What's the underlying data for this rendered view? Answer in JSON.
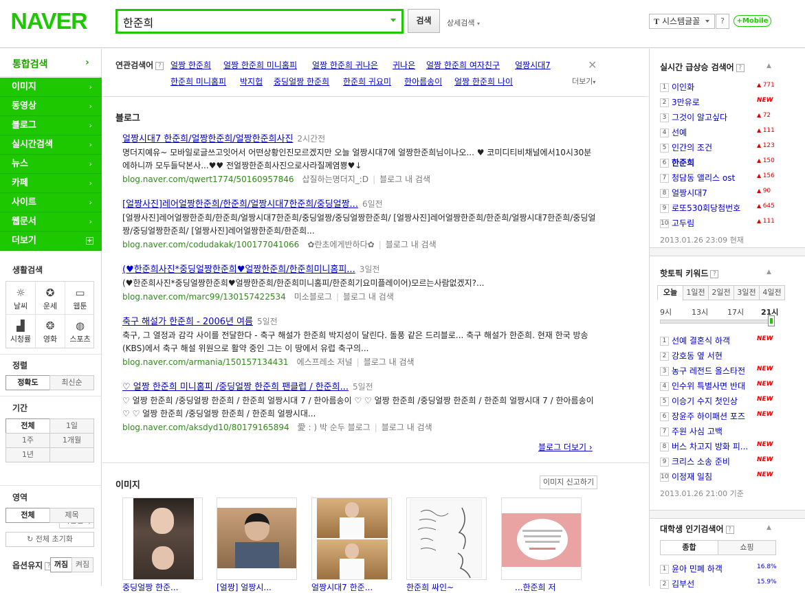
{
  "header": {
    "logo": "NAVER",
    "search_value": "한준희",
    "search_button": "검색",
    "advanced": "상세검색",
    "font_select": "시스템글꼴",
    "help": "?",
    "mobile": "+Mobile"
  },
  "leftnav": {
    "top": "통합검색",
    "items": [
      {
        "label": "이미지"
      },
      {
        "label": "동영상"
      },
      {
        "label": "블로그"
      },
      {
        "label": "실시간검색"
      },
      {
        "label": "뉴스"
      },
      {
        "label": "카페"
      },
      {
        "label": "사이트"
      },
      {
        "label": "웹문서"
      },
      {
        "label": "더보기"
      }
    ],
    "life_title": "생활검색",
    "life": [
      {
        "label": "날씨",
        "icon": "sun-icon"
      },
      {
        "label": "운세",
        "icon": "star-icon"
      },
      {
        "label": "웹툰",
        "icon": "speech-icon"
      },
      {
        "label": "시청률",
        "icon": "bar-chart-icon"
      },
      {
        "label": "영화",
        "icon": "film-reel-icon"
      },
      {
        "label": "스포츠",
        "icon": "ball-icon"
      }
    ],
    "sort_title": "정렬",
    "sort": [
      "정확도",
      "최신순"
    ],
    "period_title": "기간",
    "period": [
      "전체",
      "1일",
      "1주",
      "1개월",
      "1년",
      ""
    ],
    "direct_input": "직접입력",
    "area_title": "영역",
    "area": [
      "전체",
      "제목"
    ],
    "reset": "전체 초기화",
    "option_title": "옵션유지",
    "option": [
      "꺼짐",
      "켜짐"
    ]
  },
  "related": {
    "title": "연관검색어",
    "row1": [
      "얼짱 한준희",
      "얼짱 한준희 미니홈피",
      "얼짱 한준희 귀나은",
      "귀나은",
      "얼짱 한준희 여자친구",
      "얼짱시대7"
    ],
    "row2": [
      "한준희 미니홈피",
      "박지헙",
      "중딩얼짱 한준희",
      "한준희 귀요미",
      "한아름송이",
      "얼짱 한준희 나이"
    ],
    "more": "더보기"
  },
  "blog": {
    "title": "블로그",
    "results": [
      {
        "title": "얼짱시대7 한준희/얼짱한준희/얼짱한준희사진",
        "time": "2시간전",
        "desc": "명더지예유~ 모바일로글쓰고잇어서 어떤상황인진모르겠지만 오늘 얼짱시대7에 얼짱한준희님이나오... ♥ 코미디티비채널에서10시30분에하니까 모두들닥본사...♥♥ 전얼짱한준희사진으로사라질께염뿅♥↓",
        "url": "blog.naver.com/qwert1774/50160957846",
        "meta": "삽질하는명더지_:D",
        "inblog": "블로그 내 검색"
      },
      {
        "title": "[얼짱사진]레어얼짱한준희/한준희/얼짱시대7한준희/중딩얼짱...",
        "time": "6일전",
        "desc": "[얼짱사진]레어얼짱한준희/한준희/얼짱시대7한준희/중딩얼짱/중딩얼짱한준희/ [얼짱사진]레어얼짱한준희/한준희/얼짱시대7한준희/중딩얼짱/중딩얼짱한준희/ [얼짱사진]레어얼짱한준희/한준희...",
        "url": "blog.naver.com/codudakak/100177041066",
        "meta": "✿란초에게반하다✿",
        "inblog": "블로그 내 검색"
      },
      {
        "title": "(♥한준희사진*중딩얼짱한준희♥얼짱한준희/한준희미니홈피...",
        "time": "3일전",
        "desc": "(♥한준희사진*중딩얼짱한준희♥얼짱한준희/한준희미니홈피/한준희기요미플레이어)모르는사람없겠지?...",
        "url": "blog.naver.com/marc99/130157422534",
        "meta": "미소블로그",
        "inblog": "블로그 내 검색"
      },
      {
        "title": "축구 해설가 한준희 - 2006년 여름",
        "time": "5일전",
        "desc": "축구, 그 열정과 감각 사이를 전달한다 - 축구 해설가 한준희 박지성이 달린다. 돌풍 같은 드리블로... 축구 해설가 한준희. 현재 한국 방송(KBS)에서 축구 해설 위원으로 활약 중인 그는 이 땅에서 유럽 축구의...",
        "url": "blog.naver.com/armania/150157134431",
        "meta": "에스프레소 저널",
        "inblog": "블로그 내 검색"
      },
      {
        "title": "♡ 얼짱 한준희 미니홈피 /중딩얼짱 한준희 팬클럽 / 한준희...",
        "time": "5일전",
        "desc": "♡ 얼짱 한준희 /중딩얼짱 한준희 / 한준희 얼짱시대 7 / 한아름송이 ♡ ♡ 얼짱 한준희 /중딩얼짱 한준희 / 한준희 얼짱시대 7 / 한아름송이 ♡ ♡ 얼짱 한준희 /중딩얼짱 한준희 / 한준희 얼짱시대...",
        "url": "blog.naver.com/aksdyd10/80179165894",
        "meta": "愛 : ) 박 순두 블로그",
        "inblog": "블로그 내 검색"
      }
    ],
    "more": "블로그 더보기"
  },
  "images": {
    "title": "이미지",
    "report": "이미지 신고하기",
    "captions": [
      "중딩얼짱 한준...",
      "[얼짱] 얼짱시...",
      "얼짱시대7 한준...",
      "한준희 싸인~",
      "...한준희 저"
    ]
  },
  "realtime": {
    "title": "실시간 급상승 검색어",
    "items": [
      {
        "n": "1",
        "label": "이인화",
        "v": "771"
      },
      {
        "n": "2",
        "label": "3만유로",
        "v": "NEW"
      },
      {
        "n": "3",
        "label": "그것이 알고싶다",
        "v": "72"
      },
      {
        "n": "4",
        "label": "선예",
        "v": "111"
      },
      {
        "n": "5",
        "label": "인간의 조건",
        "v": "123"
      },
      {
        "n": "6",
        "label": "한준희",
        "v": "150"
      },
      {
        "n": "7",
        "label": "청담동 앨리스 ost",
        "v": "156"
      },
      {
        "n": "8",
        "label": "얼짱시대7",
        "v": "90"
      },
      {
        "n": "9",
        "label": "로또530회당첨번호",
        "v": "645"
      },
      {
        "n": "10",
        "label": "고두림",
        "v": "111"
      }
    ],
    "date": "2013.01.26 23:09 현재"
  },
  "hottopic": {
    "title": "핫토픽 키워드",
    "tabs": [
      "오늘",
      "1일전",
      "2일전",
      "3일전",
      "4일전"
    ],
    "hours": [
      "9시",
      "13시",
      "17시",
      "21시"
    ],
    "slider_level": 1.0,
    "items": [
      {
        "n": "1",
        "label": "선예 결혼식 하객",
        "v": "NEW"
      },
      {
        "n": "2",
        "label": "강호동 옆 서현",
        "v": ""
      },
      {
        "n": "3",
        "label": "농구 레전드 올스타전",
        "v": "NEW"
      },
      {
        "n": "4",
        "label": "인수위 특별사면 반대",
        "v": "NEW"
      },
      {
        "n": "5",
        "label": "이승기 수지 첫인상",
        "v": "NEW"
      },
      {
        "n": "6",
        "label": "장윤주 하이패션 포즈",
        "v": "NEW"
      },
      {
        "n": "7",
        "label": "주원 사심 고백",
        "v": ""
      },
      {
        "n": "8",
        "label": "버스 차고지 방화 피...",
        "v": "NEW"
      },
      {
        "n": "9",
        "label": "크리스 소송 준비",
        "v": "NEW"
      },
      {
        "n": "10",
        "label": "이정재 일침",
        "v": "NEW"
      }
    ],
    "date": "2013.01.26 21:00 기준"
  },
  "college": {
    "title": "대학생 인기검색어",
    "tabs": [
      "종합",
      "쇼핑"
    ],
    "items": [
      {
        "n": "1",
        "label": "윤아 민폐 하객",
        "v": "16.8%"
      },
      {
        "n": "2",
        "label": "김부선",
        "v": "15.9%"
      }
    ]
  },
  "colors": {
    "brand": "#1ec800",
    "link": "#0000cc",
    "url": "#2e8b18"
  }
}
